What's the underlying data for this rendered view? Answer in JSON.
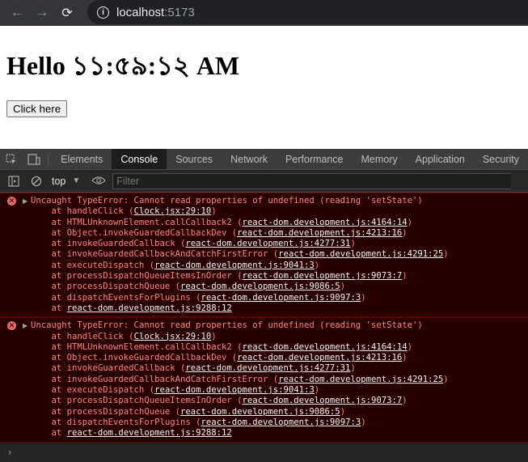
{
  "browser": {
    "back_icon": "←",
    "forward_icon": "→",
    "reload_icon": "⟳",
    "url_host": "localhost",
    "url_port": ":5173"
  },
  "page": {
    "heading": "Hello ১১:৫৯:১২ AM",
    "button_label": "Click here"
  },
  "devtools": {
    "tabs": [
      {
        "label": "Elements"
      },
      {
        "label": "Console"
      },
      {
        "label": "Sources"
      },
      {
        "label": "Network"
      },
      {
        "label": "Performance"
      },
      {
        "label": "Memory"
      },
      {
        "label": "Application"
      },
      {
        "label": "Security"
      }
    ],
    "active_tab": "Console",
    "context": "top",
    "filter_placeholder": "Filter",
    "errors": [
      {
        "message": "Uncaught TypeError: Cannot read properties of undefined (reading 'setState')",
        "stack": [
          {
            "prefix": "    at handleClick (",
            "link": "Clock.jsx:29:10",
            "suffix": ")"
          },
          {
            "prefix": "    at HTMLUnknownElement.callCallback2 (",
            "link": "react-dom.development.js:4164:14",
            "suffix": ")"
          },
          {
            "prefix": "    at Object.invokeGuardedCallbackDev (",
            "link": "react-dom.development.js:4213:16",
            "suffix": ")"
          },
          {
            "prefix": "    at invokeGuardedCallback (",
            "link": "react-dom.development.js:4277:31",
            "suffix": ")"
          },
          {
            "prefix": "    at invokeGuardedCallbackAndCatchFirstError (",
            "link": "react-dom.development.js:4291:25",
            "suffix": ")"
          },
          {
            "prefix": "    at executeDispatch (",
            "link": "react-dom.development.js:9041:3",
            "suffix": ")"
          },
          {
            "prefix": "    at processDispatchQueueItemsInOrder (",
            "link": "react-dom.development.js:9073:7",
            "suffix": ")"
          },
          {
            "prefix": "    at processDispatchQueue (",
            "link": "react-dom.development.js:9086:5",
            "suffix": ")"
          },
          {
            "prefix": "    at dispatchEventsForPlugins (",
            "link": "react-dom.development.js:9097:3",
            "suffix": ")"
          },
          {
            "prefix": "    at ",
            "link": "react-dom.development.js:9288:12",
            "suffix": ""
          }
        ]
      },
      {
        "message": "Uncaught TypeError: Cannot read properties of undefined (reading 'setState')",
        "stack": [
          {
            "prefix": "    at handleClick (",
            "link": "Clock.jsx:29:10",
            "suffix": ")"
          },
          {
            "prefix": "    at HTMLUnknownElement.callCallback2 (",
            "link": "react-dom.development.js:4164:14",
            "suffix": ")"
          },
          {
            "prefix": "    at Object.invokeGuardedCallbackDev (",
            "link": "react-dom.development.js:4213:16",
            "suffix": ")"
          },
          {
            "prefix": "    at invokeGuardedCallback (",
            "link": "react-dom.development.js:4277:31",
            "suffix": ")"
          },
          {
            "prefix": "    at invokeGuardedCallbackAndCatchFirstError (",
            "link": "react-dom.development.js:4291:25",
            "suffix": ")"
          },
          {
            "prefix": "    at executeDispatch (",
            "link": "react-dom.development.js:9041:3",
            "suffix": ")"
          },
          {
            "prefix": "    at processDispatchQueueItemsInOrder (",
            "link": "react-dom.development.js:9073:7",
            "suffix": ")"
          },
          {
            "prefix": "    at processDispatchQueue (",
            "link": "react-dom.development.js:9086:5",
            "suffix": ")"
          },
          {
            "prefix": "    at dispatchEventsForPlugins (",
            "link": "react-dom.development.js:9097:3",
            "suffix": ")"
          },
          {
            "prefix": "    at ",
            "link": "react-dom.development.js:9288:12",
            "suffix": ""
          }
        ]
      }
    ],
    "prompt_symbol": "›"
  },
  "icons": {
    "info": "info-icon",
    "inspect": "inspect-element-icon",
    "device": "device-toolbar-icon",
    "sidebar": "sidebar-toggle-icon",
    "clear": "clear-console-icon",
    "eye": "live-expression-eye-icon",
    "error": "error-icon"
  },
  "colors": {
    "error_text": "#ff8080",
    "error_bg": "#290000",
    "link": "#f2f2f2"
  }
}
